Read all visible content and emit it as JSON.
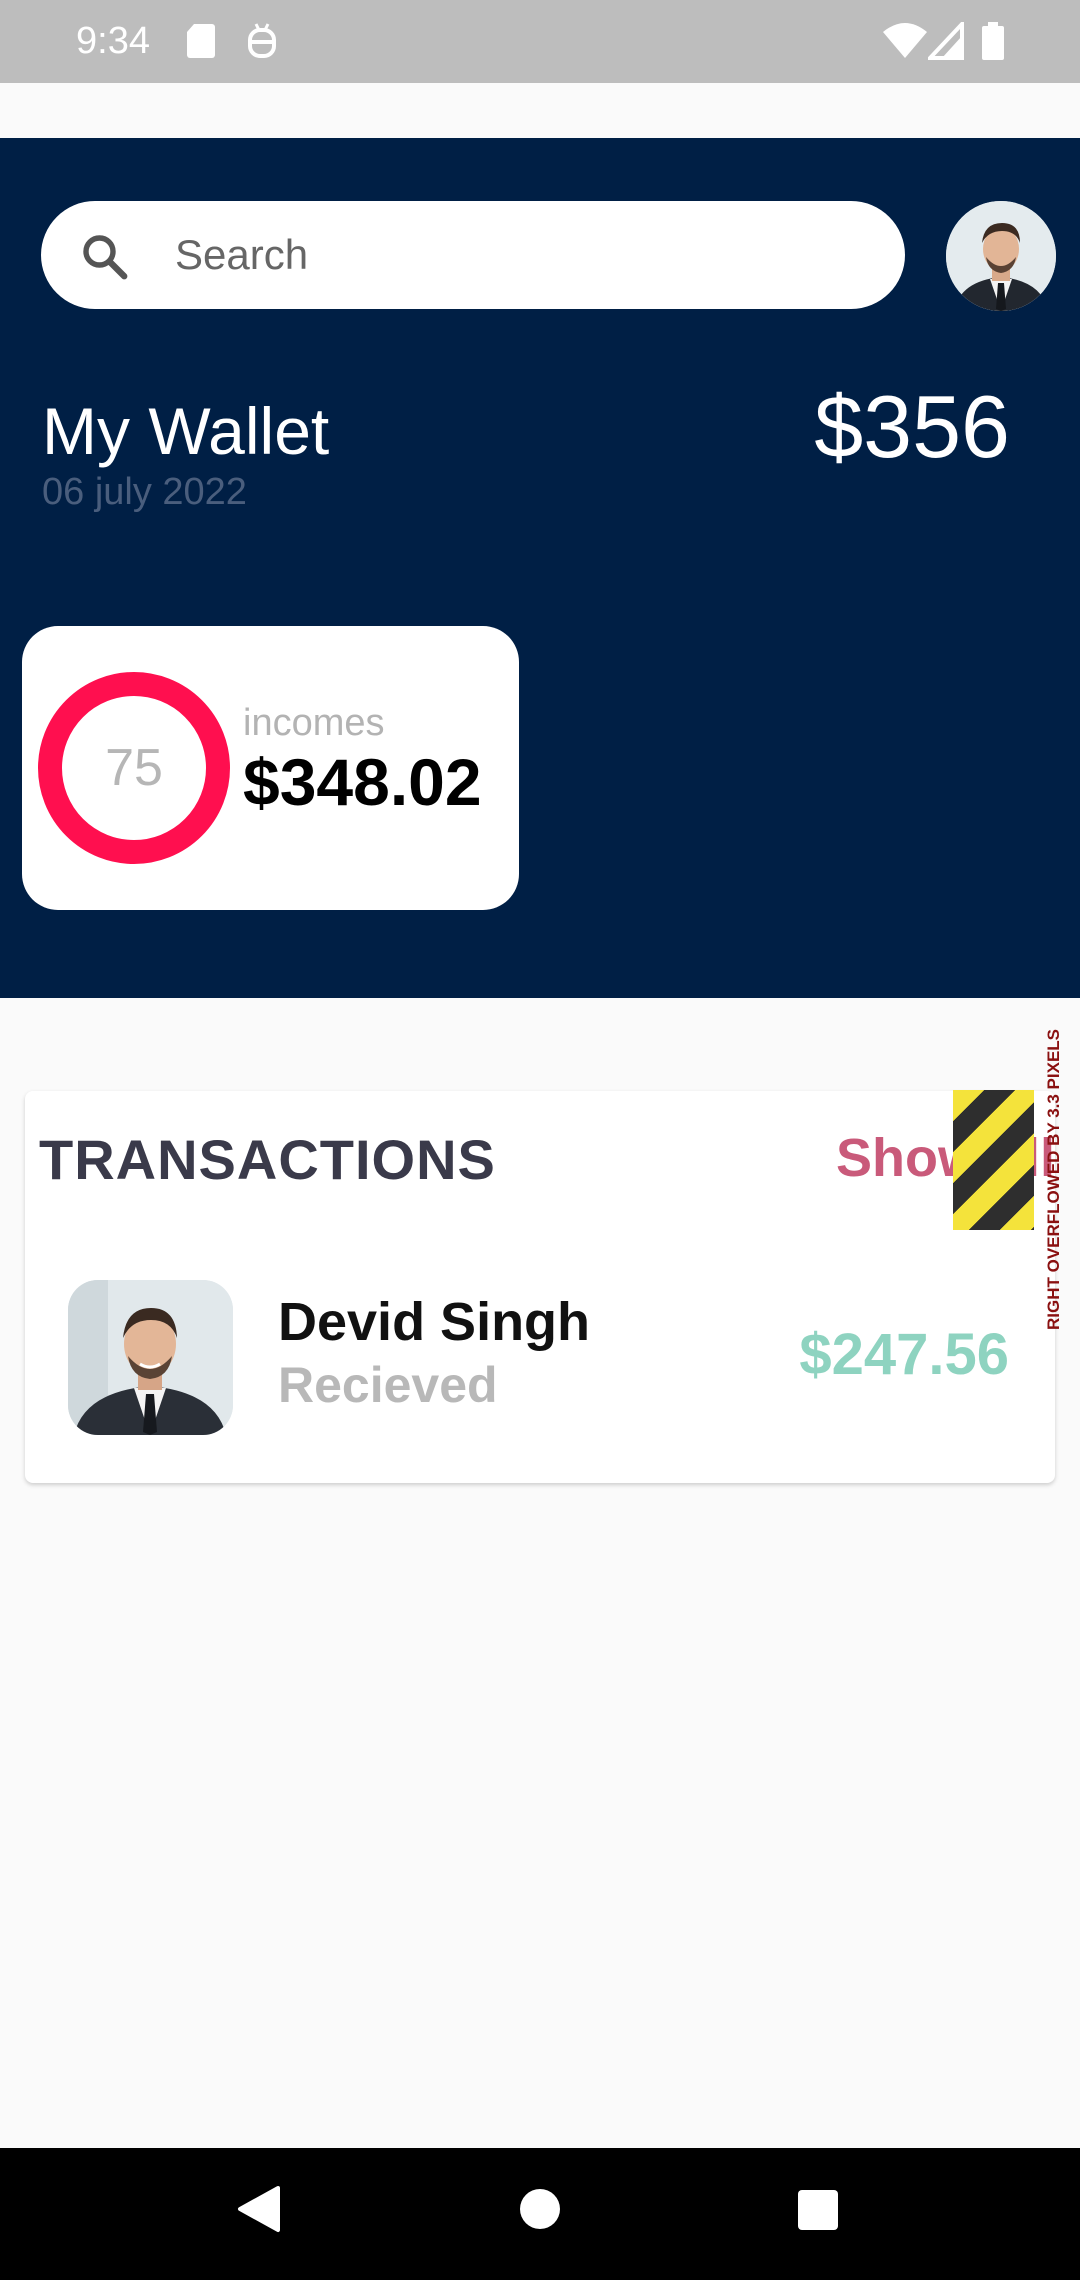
{
  "status_bar": {
    "time": "9:34",
    "icons": [
      "sd-card-icon",
      "debug-icon",
      "wifi-icon",
      "signal-icon",
      "battery-icon"
    ]
  },
  "header": {
    "search": {
      "placeholder": "Search",
      "value": ""
    },
    "wallet_title": "My Wallet",
    "wallet_date": "06 july 2022",
    "wallet_amount": "$356",
    "colors": {
      "background": "#001f45",
      "date_text": "#4a5e7d"
    }
  },
  "income_card": {
    "ring_value": "75",
    "label": "incomes",
    "amount": "$348.02",
    "ring_color": "#ff0f4f"
  },
  "transactions": {
    "title": "TRANSACTIONS",
    "show_all_label": "Show all",
    "overflow_warning": "RIGHT OVERFLOWED BY 3.3 PIXELS",
    "items": [
      {
        "name": "Devid Singh",
        "status": "Recieved",
        "amount": "$247.56",
        "amount_color": "#8ed3c0"
      }
    ]
  },
  "nav_bar": {
    "buttons": [
      "back-icon",
      "home-icon",
      "recents-icon"
    ]
  }
}
